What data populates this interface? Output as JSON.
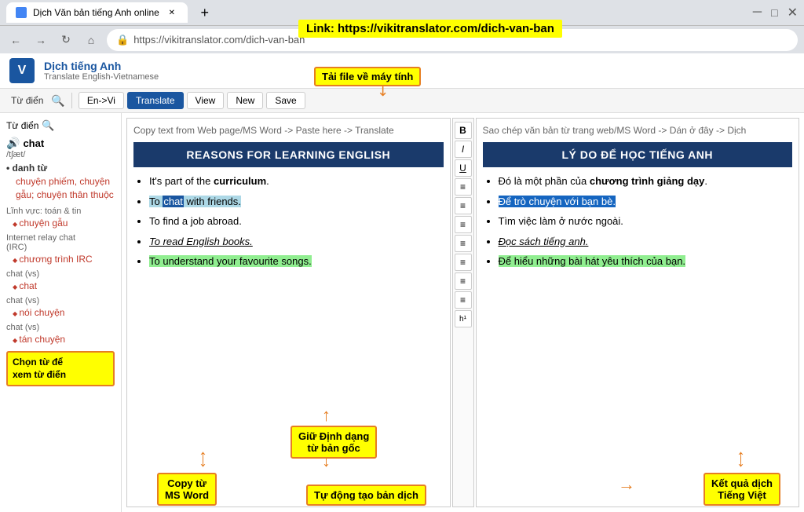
{
  "browser": {
    "tab_title": "Dịch Văn bản tiếng Anh online",
    "url": "https://vikitranslator.com/dich-van-ban",
    "link_label": "Link: https://vikitranslator.com/dich-van-ban"
  },
  "app": {
    "title": "Dịch tiếng Anh",
    "subtitle": "Translate English-Vietnamese",
    "logo_letter": "V"
  },
  "toolbar": {
    "lang_btn": "En->Vi",
    "translate_btn": "Translate",
    "view_btn": "View",
    "new_btn": "New",
    "save_btn": "Save",
    "dict_label": "Từ điển"
  },
  "formatting": {
    "bold": "B",
    "italic": "I",
    "underline": "U",
    "align_left": "≡",
    "align_center": "≡",
    "align_right": "≡",
    "indent": "≡",
    "outdent": "≡",
    "list_ol": "≡",
    "list_ul": "≡",
    "heading": "h¹"
  },
  "editor": {
    "hint": "Copy text from Web page/MS Word -> Paste here -> Translate",
    "heading": "REASONS FOR LEARNING ENGLISH",
    "bullets": [
      {
        "text": "It's part of the ",
        "bold": "curriculum",
        "suffix": ".",
        "style": "normal"
      },
      {
        "text": "To ",
        "highlight_word": "chat",
        "rest": " with friends.",
        "style": "highlight"
      },
      {
        "text": "To find a job abroad.",
        "style": "normal"
      },
      {
        "text": "To read English books.",
        "style": "underline-italic"
      },
      {
        "text": "To understand your favourite songs.",
        "style": "green"
      }
    ]
  },
  "result": {
    "hint": "Sao chép văn bản từ trang web/MS Word -> Dán ở đây -> Dịch",
    "heading": "LÝ DO ĐỂ HỌC TIẾNG ANH",
    "bullets": [
      {
        "text": "Đó là một phần của ",
        "bold": "chương trình giảng dạy",
        "suffix": ".",
        "style": "normal"
      },
      {
        "text": "Để trò chuyện với bạn bè.",
        "style": "blue-highlight"
      },
      {
        "text": "Tìm việc làm ở nước ngoài.",
        "style": "normal"
      },
      {
        "text": "Đọc sách tiếng anh.",
        "style": "underline-italic"
      },
      {
        "text": "Để hiểu những bài hát yêu thích của bạn.",
        "style": "green"
      }
    ]
  },
  "sidebar": {
    "dict_label": "Từ điển",
    "word": "chat",
    "phonetic": "/tʃæt/",
    "audio_icon": "🔊",
    "section1": {
      "title": "danh từ",
      "links": [
        "chuyện phiếm, chuyện gẫu; chuyện thân thuộc"
      ]
    },
    "categories": [
      {
        "title": "Lĩnh vực: toán & tin",
        "items": [
          "chuyện gẫu"
        ]
      },
      {
        "title": "Internet relay chat (IRC)",
        "items": [
          "chương trình IRC"
        ]
      },
      {
        "title": "chat (vs)",
        "items": [
          "chat"
        ]
      },
      {
        "title": "chat (vs)",
        "items": [
          "nói chuyện"
        ]
      },
      {
        "title": "chat (vs)",
        "items": [
          "tán chuyện"
        ]
      }
    ]
  },
  "annotations": {
    "link_label": "Link: https://vikitranslator.com/dich-van-ban",
    "tai_file": "Tải file về máy tính",
    "chon_tu": "Chọn từ để\nxem từ điển",
    "giu_dinh_dang": "Giữ Định dạng\ntừ bản gốc",
    "copy_ms_word": "Copy từ\nMS Word",
    "tu_dong_tao": "Tự động tạo bản dịch",
    "ket_qua_dich": "Kết quả dịch\nTiếng Việt"
  }
}
